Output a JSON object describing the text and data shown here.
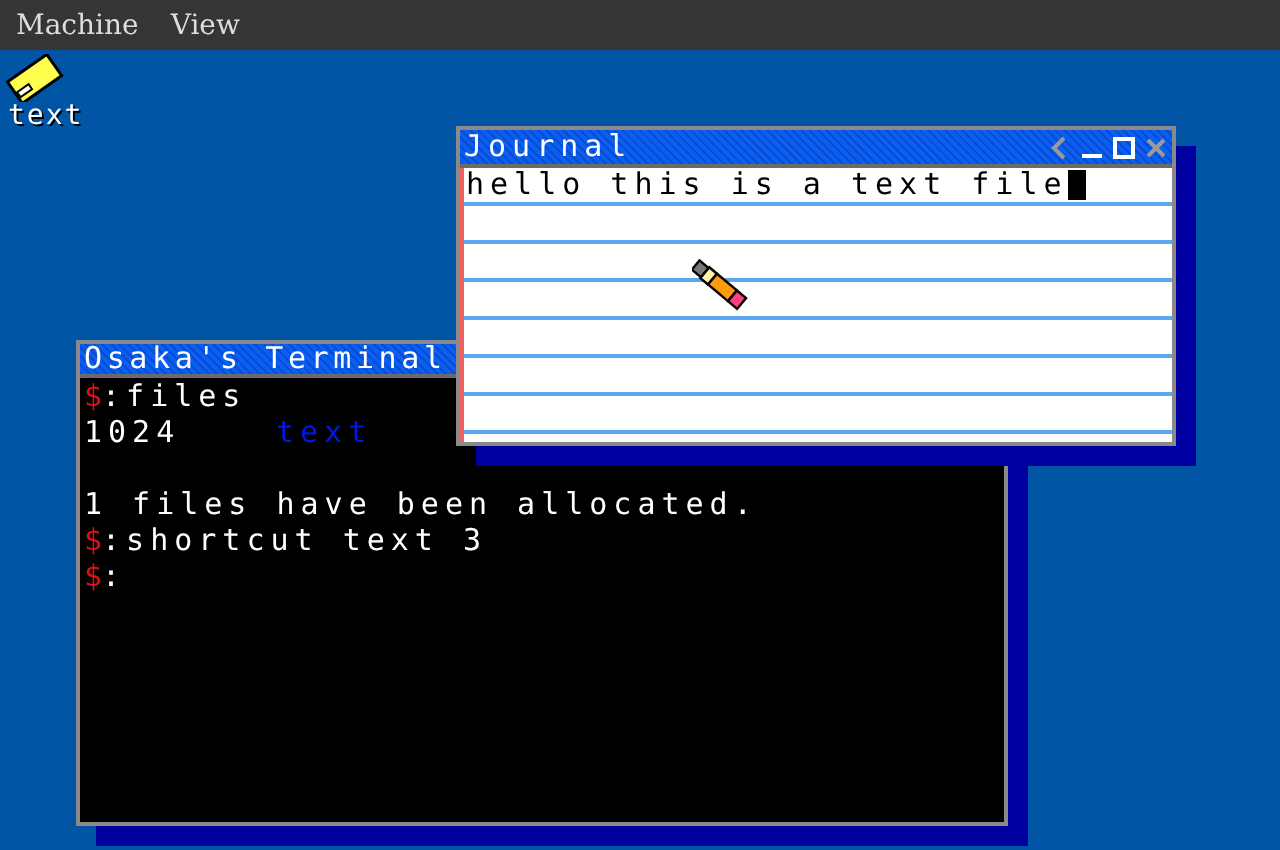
{
  "menu": [
    {
      "label": "Machine"
    },
    {
      "label": "View"
    }
  ],
  "desktop_icons": [
    {
      "label": "text"
    }
  ],
  "terminal": {
    "title": "Osaka's Terminal",
    "lines": [
      {
        "kind": "command",
        "prompt": "$",
        "text": ":files"
      },
      {
        "kind": "listing",
        "size": "1024",
        "name": "text"
      },
      {
        "kind": "blank"
      },
      {
        "kind": "output",
        "text": "1 files have been allocated."
      },
      {
        "kind": "command",
        "prompt": "$",
        "text": ":shortcut text 3"
      },
      {
        "kind": "command",
        "prompt": "$",
        "text": ":"
      }
    ]
  },
  "journal": {
    "title": "Journal",
    "text": "hello this is a text file"
  }
}
